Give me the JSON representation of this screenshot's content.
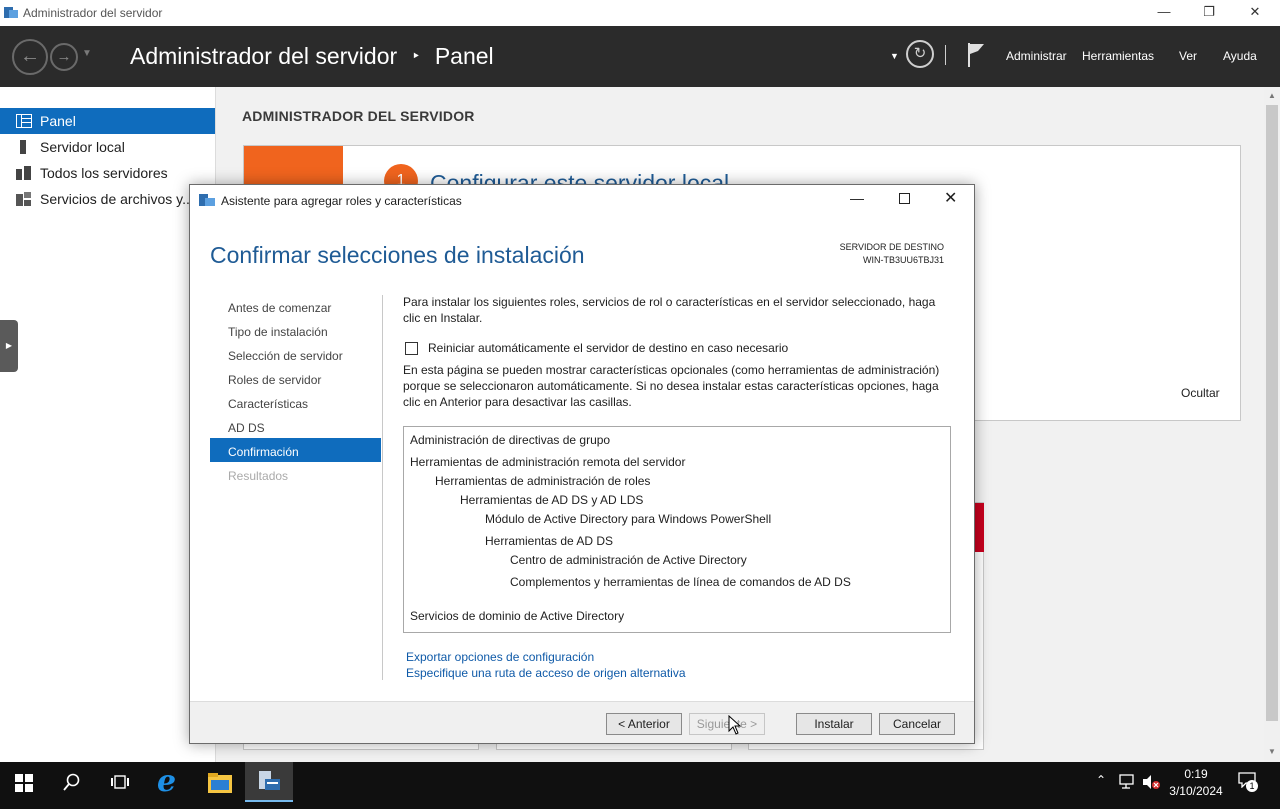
{
  "window": {
    "title": "Administrador del servidor",
    "controls": {
      "minimize": "—",
      "restore": "❐",
      "close": "✕"
    }
  },
  "header": {
    "breadcrumb_root": "Administrador del servidor",
    "breadcrumb_sep": "‣",
    "breadcrumb_page": "Panel",
    "menu": [
      "Administrar",
      "Herramientas",
      "Ver",
      "Ayuda"
    ]
  },
  "sidebar": {
    "items": [
      {
        "label": "Panel",
        "icon": "dashboard-icon",
        "selected": true
      },
      {
        "label": "Servidor local",
        "icon": "server-icon",
        "selected": false
      },
      {
        "label": "Todos los servidores",
        "icon": "servers-icon",
        "selected": false
      },
      {
        "label": "Servicios de archivos y...",
        "icon": "file-services-icon",
        "selected": false
      }
    ]
  },
  "main": {
    "heading": "ADMINISTRADOR DEL SERVIDOR",
    "quickstart_number": "1",
    "quickstart_title": "Configurar este servidor local",
    "hide_label": "Ocultar"
  },
  "dialog": {
    "title": "Asistente para agregar roles y características",
    "header": "Confirmar selecciones de instalación",
    "dest_label": "SERVIDOR DE DESTINO",
    "dest_server": "WIN-TB3UU6TBJ31",
    "steps": [
      {
        "label": "Antes de comenzar",
        "state": "normal"
      },
      {
        "label": "Tipo de instalación",
        "state": "normal"
      },
      {
        "label": "Selección de servidor",
        "state": "normal"
      },
      {
        "label": "Roles de servidor",
        "state": "normal"
      },
      {
        "label": "Características",
        "state": "normal"
      },
      {
        "label": "AD DS",
        "state": "normal"
      },
      {
        "label": "Confirmación",
        "state": "selected"
      },
      {
        "label": "Resultados",
        "state": "disabled"
      }
    ],
    "intro": "Para instalar los siguientes roles, servicios de rol o características en el servidor seleccionado, haga clic en Instalar.",
    "restart_checkbox": "Reiniciar automáticamente el servidor de destino en caso necesario",
    "restart_checked": false,
    "optional_note": "En esta página se pueden mostrar características opcionales (como herramientas de administración) porque se seleccionaron automáticamente. Si no desea instalar estas características opciones, haga clic en Anterior para desactivar las casillas.",
    "features": [
      {
        "label": "Administración de directivas de grupo",
        "level": 0
      },
      {
        "label": "Herramientas de administración remota del servidor",
        "level": 0
      },
      {
        "label": "Herramientas de administración de roles",
        "level": 1
      },
      {
        "label": "Herramientas de AD DS y AD LDS",
        "level": 2
      },
      {
        "label": "Módulo de Active Directory para Windows PowerShell",
        "level": 3
      },
      {
        "label": "Herramientas de AD DS",
        "level": 3
      },
      {
        "label": "Centro de administración de Active Directory",
        "level": 4
      },
      {
        "label": "Complementos y herramientas de línea de comandos de AD DS",
        "level": 4
      },
      {
        "label": "Servicios de dominio de Active Directory",
        "level": 0
      }
    ],
    "links": [
      "Exportar opciones de configuración",
      "Especifique una ruta de acceso de origen alternativa"
    ],
    "buttons": {
      "back": "< Anterior",
      "next": "Siguiente >",
      "install": "Instalar",
      "cancel": "Cancelar"
    }
  },
  "taskbar": {
    "time": "0:19",
    "date": "3/10/2024",
    "notification_count": "1"
  },
  "colors": {
    "accent": "#0f6cbd",
    "header_bg": "#2b2b2b",
    "orange_tile": "#f0641e",
    "red_tile": "#c8001e"
  }
}
